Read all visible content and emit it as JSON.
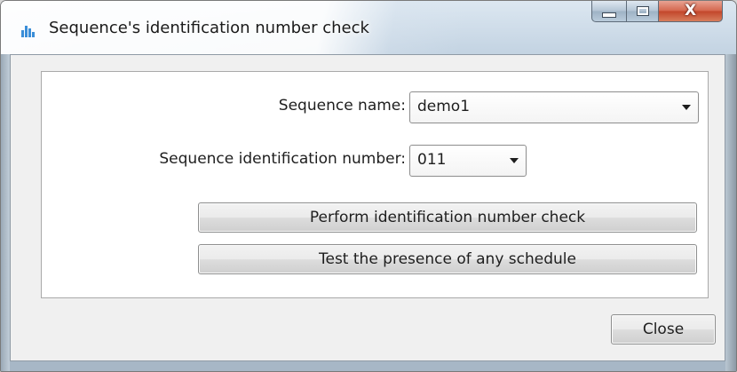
{
  "window": {
    "title": "Sequence's identification number check",
    "icon": "bar-chart-icon",
    "caption_buttons": {
      "minimize_icon": "minimize-icon",
      "maximize_icon": "maximize-icon",
      "close_glyph": "X"
    }
  },
  "form": {
    "sequence_name_label": "Sequence name:",
    "sequence_name_value": "demo1",
    "sequence_id_label": "Sequence identification number:",
    "sequence_id_value": "011"
  },
  "actions": {
    "check_label": "Perform identification number check",
    "test_label": "Test the presence of any schedule"
  },
  "footer": {
    "close_label": "Close"
  },
  "colors": {
    "close_button": "#c2452a",
    "client_background": "#f0f0f0",
    "icon_blue": "#3b8ed8"
  }
}
